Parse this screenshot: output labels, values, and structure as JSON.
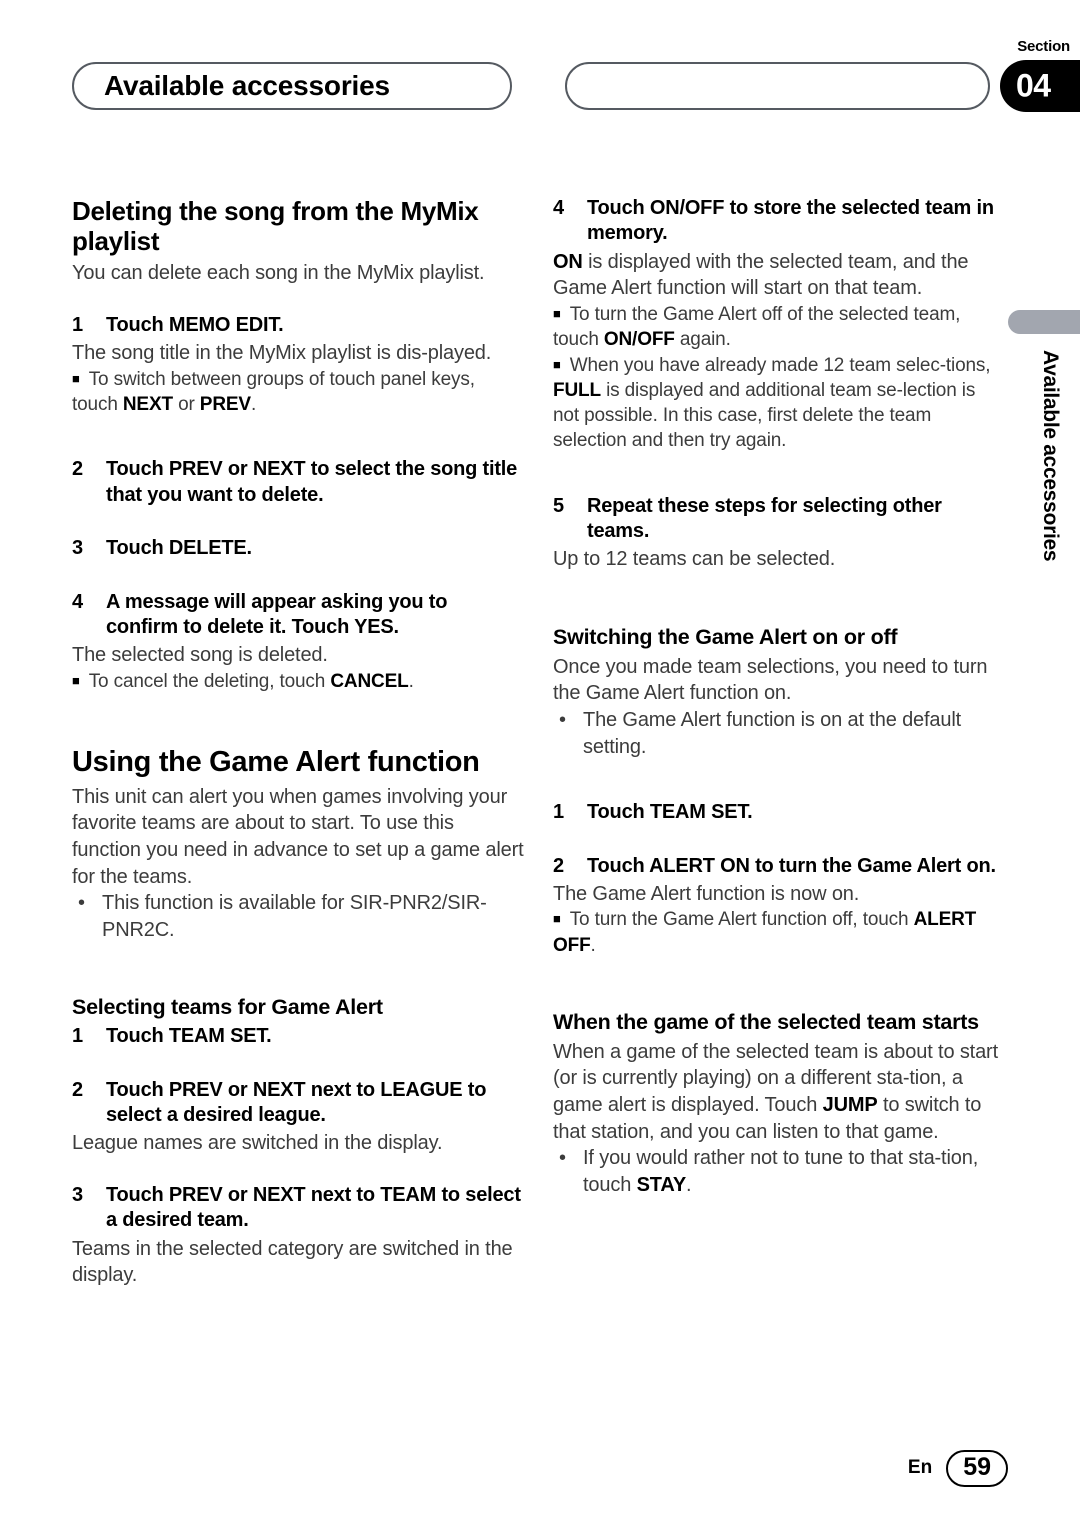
{
  "header": {
    "title_pill": "Available accessories",
    "blank_pill": "",
    "section_label": "Section",
    "section_number": "04"
  },
  "side_tab": {
    "label": "Available accessories",
    "bar_color": "#a2a6af"
  },
  "footer": {
    "language": "En",
    "page_number": "59"
  },
  "left_column": {
    "heading_1": "Deleting the song from the MyMix playlist",
    "intro_1": "You can delete each song in the MyMix playlist.",
    "step_1_num": "1",
    "step_1_text": "Touch MEMO EDIT.",
    "step_1_body": "The song title in the MyMix playlist is dis-played.",
    "step_1_note_prefix": "To switch between groups of touch panel keys, touch ",
    "step_1_note_bold_a": "NEXT",
    "step_1_note_mid": " or ",
    "step_1_note_bold_b": "PREV",
    "step_1_note_suffix": ".",
    "step_2_num": "2",
    "step_2_text": "Touch PREV or NEXT to select the song title that you want to delete.",
    "step_3_num": "3",
    "step_3_text": "Touch DELETE.",
    "step_4_num": "4",
    "step_4_text": "A message will appear asking you to confirm to delete it. Touch YES.",
    "step_4_body": "The selected song is deleted.",
    "step_4_note_prefix": "To cancel the deleting, touch ",
    "step_4_note_bold": "CANCEL",
    "step_4_note_suffix": ".",
    "heading_2": "Using the Game Alert function",
    "intro_2": "This unit can alert you when games involving your favorite teams are about to start. To use this function you need in advance to set up a game alert for the teams.",
    "intro_2_dot": "This function is available for SIR-PNR2/SIR-PNR2C.",
    "heading_3": "Selecting teams for Game Alert",
    "t_step_1_num": "1",
    "t_step_1_text": "Touch TEAM SET.",
    "t_step_2_num": "2",
    "t_step_2_text": "Touch PREV or NEXT next to LEAGUE to select a desired league.",
    "t_step_2_body": "League names are switched in the display.",
    "t_step_3_num": "3",
    "t_step_3_text": "Touch PREV or NEXT next to TEAM to select a desired team.",
    "t_step_3_body": "Teams in the selected category are switched in the display."
  },
  "right_column": {
    "step_4_num": "4",
    "step_4_text": "Touch ON/OFF to store the selected team in memory.",
    "step_4_body_bold": "ON",
    "step_4_body_rest": " is displayed with the selected team, and the Game Alert function will start on that team.",
    "step_4_note_a_prefix": "To turn the Game Alert off of the selected team, touch ",
    "step_4_note_a_bold": "ON/OFF",
    "step_4_note_a_suffix": " again.",
    "step_4_note_b_prefix": "When you have already made 12 team selec-tions, ",
    "step_4_note_b_bold": "FULL",
    "step_4_note_b_suffix": " is displayed and additional team se-lection is not possible. In this case, first delete the team selection and then try again.",
    "step_5_num": "5",
    "step_5_text": "Repeat these steps for selecting other teams.",
    "step_5_body": "Up to 12 teams can be selected.",
    "heading_1": "Switching the Game Alert on or off",
    "intro_1": "Once you made team selections, you need to turn the Game Alert function on.",
    "intro_1_dot": "The Game Alert function is on at the default setting.",
    "s_step_1_num": "1",
    "s_step_1_text": "Touch TEAM SET.",
    "s_step_2_num": "2",
    "s_step_2_text": "Touch ALERT ON to turn the Game Alert on.",
    "s_step_2_body": "The Game Alert function is now on.",
    "s_step_2_note_prefix": "To turn the Game Alert function off, touch ",
    "s_step_2_note_bold": "ALERT OFF",
    "s_step_2_note_suffix": ".",
    "heading_2": "When the game of the selected team starts",
    "intro_2_a": "When a game of the selected team is about to start (or is currently playing) on a different sta-tion, a game alert is displayed. Touch ",
    "intro_2_bold": "JUMP",
    "intro_2_b": " to switch to that station, and you can listen to that game.",
    "intro_2_dot_a": "If you would rather not to tune to that sta-tion, touch ",
    "intro_2_dot_bold": "STAY",
    "intro_2_dot_b": "."
  }
}
